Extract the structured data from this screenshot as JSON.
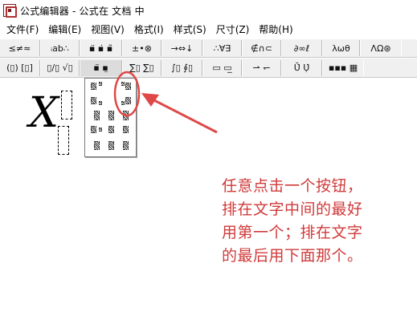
{
  "window": {
    "title": "公式编辑器 - 公式在 文档 中"
  },
  "menu": {
    "items": [
      "文件(F)",
      "编辑(E)",
      "视图(V)",
      "格式(I)",
      "样式(S)",
      "尺寸(Z)",
      "帮助(H)"
    ]
  },
  "toolbar_row1": {
    "buttons": [
      "≤≠≈",
      "ᵢab∴",
      "▪̈ ▪̇ ▪̃",
      "±•⊗",
      "→⇔↓",
      "∴∀∃",
      "∉∩⊂",
      "∂∞ℓ",
      "λωθ",
      "ΛΩ⊛"
    ]
  },
  "toolbar_row2": {
    "buttons": [
      "(▯) [▯]",
      "▯/▯ √▯",
      "▪̈ ▪̤",
      "∑▯ ∑▯",
      "∫▯ ∮▯",
      "▭ ▭̲",
      "⇀ ↽",
      "Ū̇ Ụ̇",
      "▪▪▪ ▦"
    ]
  },
  "palette": {
    "cells": [
      "sup-left",
      "sup-right",
      "sub-left",
      "sub-right",
      "subsup-left",
      "subsup-right",
      "over-1",
      "over-2",
      "under-1",
      "under-2",
      "mid-1",
      "mid-2",
      "mid-3",
      "low-1",
      "low-2",
      "low-3"
    ]
  },
  "equation": {
    "variable": "X"
  },
  "annotation": {
    "lines": [
      "任意点击一个按钮，",
      "排在文字中间的最好",
      "用第一个；排在文字",
      "的最后用下面那个。"
    ]
  },
  "colors": {
    "annotation": "#d03a3a",
    "highlight": "#e04848",
    "toolbar_bg": "#f0f0f0"
  }
}
